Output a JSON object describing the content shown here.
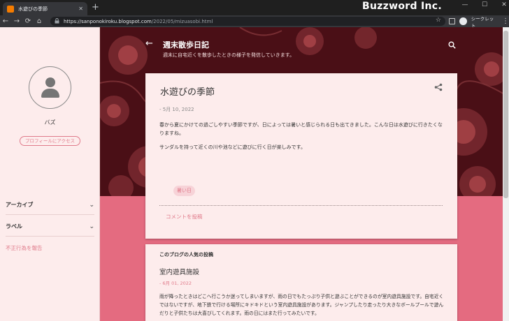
{
  "browser": {
    "tab_title": "水遊びの季節",
    "tab_close": "✕",
    "new_tab": "+",
    "url_host": "https://sanponokiroku.blogspot.com",
    "url_path": "/2022/05/mizuasobi.html",
    "brand": "Buzzword Inc.",
    "incognito_label": "シークレット",
    "nav": {
      "back": "←",
      "forward": "→",
      "reload": "⟳",
      "home": "⌂"
    },
    "window_controls": {
      "minimize": "—",
      "maximize": "☐",
      "close": "✕"
    },
    "star": "☆",
    "menu": "⋮",
    "lock": "🔒"
  },
  "sidebar": {
    "author_name": "バズ",
    "profile_button": "プロフィールにアクセス",
    "archive_label": "アーカイブ",
    "labels_label": "ラベル",
    "chevron": "⌄",
    "report_link": "不正行為を報告"
  },
  "header": {
    "back": "←",
    "blog_title": "週末散歩日記",
    "blog_description": "週末に自宅近くを散歩したときの様子を発信していきます。"
  },
  "post": {
    "title": "水遊びの季節",
    "date": "- 5月 10, 2022",
    "paragraph1": "春から夏にかけての過ごしやすい季節ですが、日によっては暑いと感じられる日も出てきました。こんな日は水遊びに行きたくなりますね。",
    "paragraph2": "サンダルを持って近くの川や池などに遊びに行く日が楽しみです。",
    "label": "暑い日",
    "comment_link": "コメントを投稿"
  },
  "popular": {
    "heading": "このブログの人気の投稿",
    "title": "室内遊具施設",
    "date": "- 6月 01, 2022",
    "snippet": "雨が降ったときはどこへ行こうか迷ってしまいますが、雨の日でもたっぷり子供と遊ぶことができるのが室内遊具施設です。自宅近くではないですが、地下鉄で行ける場所にキドキドという室内遊具施設があります。ジャンプしたり走ったり大きなボールプールで遊んだりと子供たちは大喜びしてくれます。雨の日にはまた行ってみたいです。"
  },
  "colors": {
    "accent": "#e07a8a",
    "hero_bg": "#4a0f16",
    "pink_bg": "#e46b80",
    "card_bg": "#fdecec"
  }
}
